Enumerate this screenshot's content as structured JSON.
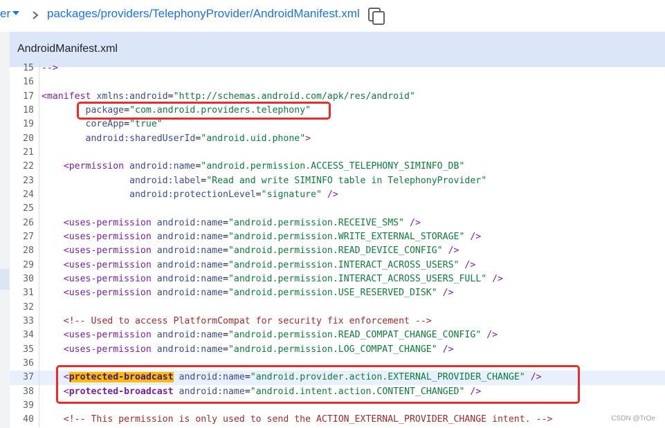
{
  "breadcrumb": {
    "branch_tail": "er",
    "path_parts": [
      "packages",
      "providers",
      "TelephonyProvider",
      "AndroidManifest.xml"
    ]
  },
  "file": {
    "name": "AndroidManifest.xml"
  },
  "code_lines": [
    {
      "n": "15",
      "segs": [
        {
          "c": "tag",
          "t": "-->"
        }
      ]
    },
    {
      "n": "16",
      "segs": []
    },
    {
      "n": "17",
      "segs": [
        {
          "c": "tag",
          "t": "<manifest "
        },
        {
          "c": "at",
          "t": "xmlns:android"
        },
        {
          "c": "",
          "t": "="
        },
        {
          "c": "val",
          "t": "\"http://schemas.android.com/apk/res/android\""
        }
      ]
    },
    {
      "n": "18",
      "segs": [
        {
          "c": "",
          "t": "        "
        },
        {
          "c": "at",
          "t": "package"
        },
        {
          "c": "",
          "t": "="
        },
        {
          "c": "val",
          "t": "\"com.android.providers.telephony\""
        }
      ]
    },
    {
      "n": "19",
      "segs": [
        {
          "c": "",
          "t": "        "
        },
        {
          "c": "at",
          "t": "coreApp"
        },
        {
          "c": "",
          "t": "="
        },
        {
          "c": "val",
          "t": "\"true\""
        }
      ]
    },
    {
      "n": "20",
      "segs": [
        {
          "c": "",
          "t": "        "
        },
        {
          "c": "at",
          "t": "android:sharedUserId"
        },
        {
          "c": "",
          "t": "="
        },
        {
          "c": "val",
          "t": "\"android.uid.phone\""
        },
        {
          "c": "tag",
          "t": ">"
        }
      ]
    },
    {
      "n": "21",
      "segs": []
    },
    {
      "n": "22",
      "segs": [
        {
          "c": "",
          "t": "    "
        },
        {
          "c": "tag",
          "t": "<permission "
        },
        {
          "c": "at",
          "t": "android:name"
        },
        {
          "c": "",
          "t": "="
        },
        {
          "c": "val",
          "t": "\"android.permission.ACCESS_TELEPHONY_SIMINFO_DB\""
        }
      ]
    },
    {
      "n": "23",
      "segs": [
        {
          "c": "",
          "t": "                "
        },
        {
          "c": "at",
          "t": "android:label"
        },
        {
          "c": "",
          "t": "="
        },
        {
          "c": "val",
          "t": "\"Read and write SIMINFO table in TelephonyProvider\""
        }
      ]
    },
    {
      "n": "24",
      "segs": [
        {
          "c": "",
          "t": "                "
        },
        {
          "c": "at",
          "t": "android:protectionLevel"
        },
        {
          "c": "",
          "t": "="
        },
        {
          "c": "val",
          "t": "\"signature\""
        },
        {
          "c": "tag",
          "t": " />"
        }
      ]
    },
    {
      "n": "25",
      "segs": []
    },
    {
      "n": "26",
      "segs": [
        {
          "c": "",
          "t": "    "
        },
        {
          "c": "tag",
          "t": "<uses-permission "
        },
        {
          "c": "at",
          "t": "android:name"
        },
        {
          "c": "",
          "t": "="
        },
        {
          "c": "val",
          "t": "\"android.permission.RECEIVE_SMS\""
        },
        {
          "c": "tag",
          "t": " />"
        }
      ]
    },
    {
      "n": "27",
      "segs": [
        {
          "c": "",
          "t": "    "
        },
        {
          "c": "tag",
          "t": "<uses-permission "
        },
        {
          "c": "at",
          "t": "android:name"
        },
        {
          "c": "",
          "t": "="
        },
        {
          "c": "val",
          "t": "\"android.permission.WRITE_EXTERNAL_STORAGE\""
        },
        {
          "c": "tag",
          "t": " />"
        }
      ]
    },
    {
      "n": "28",
      "segs": [
        {
          "c": "",
          "t": "    "
        },
        {
          "c": "tag",
          "t": "<uses-permission "
        },
        {
          "c": "at",
          "t": "android:name"
        },
        {
          "c": "",
          "t": "="
        },
        {
          "c": "val",
          "t": "\"android.permission.READ_DEVICE_CONFIG\""
        },
        {
          "c": "tag",
          "t": " />"
        }
      ]
    },
    {
      "n": "29",
      "segs": [
        {
          "c": "",
          "t": "    "
        },
        {
          "c": "tag",
          "t": "<uses-permission "
        },
        {
          "c": "at",
          "t": "android:name"
        },
        {
          "c": "",
          "t": "="
        },
        {
          "c": "val",
          "t": "\"android.permission.INTERACT_ACROSS_USERS\""
        },
        {
          "c": "tag",
          "t": " />"
        }
      ]
    },
    {
      "n": "30",
      "segs": [
        {
          "c": "",
          "t": "    "
        },
        {
          "c": "tag",
          "t": "<uses-permission "
        },
        {
          "c": "at",
          "t": "android:name"
        },
        {
          "c": "",
          "t": "="
        },
        {
          "c": "val",
          "t": "\"android.permission.INTERACT_ACROSS_USERS_FULL\""
        },
        {
          "c": "tag",
          "t": " />"
        }
      ]
    },
    {
      "n": "31",
      "segs": [
        {
          "c": "",
          "t": "    "
        },
        {
          "c": "tag",
          "t": "<uses-permission "
        },
        {
          "c": "at",
          "t": "android:name"
        },
        {
          "c": "",
          "t": "="
        },
        {
          "c": "val",
          "t": "\"android.permission.USE_RESERVED_DISK\""
        },
        {
          "c": "tag",
          "t": " />"
        }
      ]
    },
    {
      "n": "32",
      "segs": []
    },
    {
      "n": "33",
      "segs": [
        {
          "c": "",
          "t": "    "
        },
        {
          "c": "cm",
          "t": "<!-- Used to access PlatformCompat for security fix enforcement -->"
        }
      ]
    },
    {
      "n": "34",
      "segs": [
        {
          "c": "",
          "t": "    "
        },
        {
          "c": "tag",
          "t": "<uses-permission "
        },
        {
          "c": "at",
          "t": "android:name"
        },
        {
          "c": "",
          "t": "="
        },
        {
          "c": "val",
          "t": "\"android.permission.READ_COMPAT_CHANGE_CONFIG\""
        },
        {
          "c": "tag",
          "t": " />"
        }
      ]
    },
    {
      "n": "35",
      "segs": [
        {
          "c": "",
          "t": "    "
        },
        {
          "c": "tag",
          "t": "<uses-permission "
        },
        {
          "c": "at",
          "t": "android:name"
        },
        {
          "c": "",
          "t": "="
        },
        {
          "c": "val",
          "t": "\"android.permission.LOG_COMPAT_CHANGE\""
        },
        {
          "c": "tag",
          "t": " />"
        }
      ]
    },
    {
      "n": "36",
      "segs": []
    },
    {
      "n": "37",
      "hl": true,
      "segs": [
        {
          "c": "",
          "t": "    "
        },
        {
          "c": "tag",
          "t": "<"
        },
        {
          "c": "kw yel",
          "t": "protected-broadcast"
        },
        {
          "c": "",
          "t": " "
        },
        {
          "c": "at",
          "t": "android:name"
        },
        {
          "c": "",
          "t": "="
        },
        {
          "c": "val",
          "t": "\"android.provider.action.EXTERNAL_PROVIDER_CHANGE\""
        },
        {
          "c": "tag",
          "t": " />"
        }
      ]
    },
    {
      "n": "38",
      "segs": [
        {
          "c": "",
          "t": "    "
        },
        {
          "c": "tag",
          "t": "<"
        },
        {
          "c": "kw",
          "t": "protected-broadcast"
        },
        {
          "c": "",
          "t": " "
        },
        {
          "c": "at",
          "t": "android:name"
        },
        {
          "c": "",
          "t": "="
        },
        {
          "c": "val",
          "t": "\"android.intent.action.CONTENT_CHANGED\""
        },
        {
          "c": "tag",
          "t": " />"
        }
      ]
    },
    {
      "n": "39",
      "segs": []
    },
    {
      "n": "40",
      "segs": [
        {
          "c": "",
          "t": "    "
        },
        {
          "c": "cm",
          "t": "<!-- This permission is only used to send the ACTION_EXTERNAL_PROVIDER_CHANGE intent. -->"
        }
      ]
    }
  ],
  "watermark": "CSDN @TrOe",
  "colors": {
    "link_blue": "#1a73e8",
    "file_header_bg": "#dbe7f8",
    "highlight_line": "#e8f0fe",
    "search_highlight": "#fbbc04",
    "annotation_red": "#ee2b2b"
  }
}
